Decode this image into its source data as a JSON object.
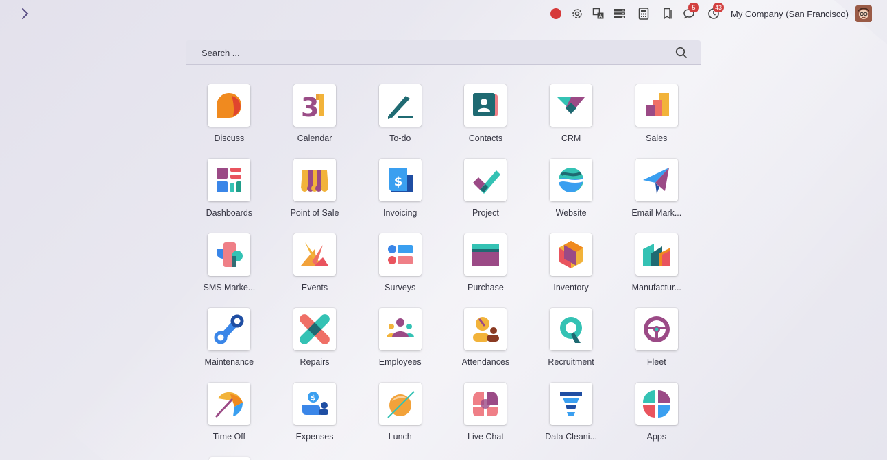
{
  "topbar": {
    "company": "My Company (San Francisco)",
    "messages_badge": "5",
    "activities_badge": "43",
    "icons": [
      "record-icon",
      "settings-icon",
      "translate-icon",
      "debug-icon",
      "calculator-icon",
      "bookmark-icon",
      "chat-icon",
      "clock-icon"
    ]
  },
  "search": {
    "placeholder": "Search ..."
  },
  "apps": [
    {
      "label": "Discuss",
      "icon": "discuss-icon"
    },
    {
      "label": "Calendar",
      "icon": "calendar-icon"
    },
    {
      "label": "To-do",
      "icon": "todo-icon"
    },
    {
      "label": "Contacts",
      "icon": "contacts-icon"
    },
    {
      "label": "CRM",
      "icon": "crm-icon"
    },
    {
      "label": "Sales",
      "icon": "sales-icon"
    },
    {
      "label": "Dashboards",
      "icon": "dashboards-icon"
    },
    {
      "label": "Point of Sale",
      "icon": "pos-icon"
    },
    {
      "label": "Invoicing",
      "icon": "invoicing-icon"
    },
    {
      "label": "Project",
      "icon": "project-icon"
    },
    {
      "label": "Website",
      "icon": "website-icon"
    },
    {
      "label": "Email Mark...",
      "icon": "email-marketing-icon"
    },
    {
      "label": "SMS Marke...",
      "icon": "sms-marketing-icon"
    },
    {
      "label": "Events",
      "icon": "events-icon"
    },
    {
      "label": "Surveys",
      "icon": "surveys-icon"
    },
    {
      "label": "Purchase",
      "icon": "purchase-icon"
    },
    {
      "label": "Inventory",
      "icon": "inventory-icon"
    },
    {
      "label": "Manufactur...",
      "icon": "manufacturing-icon"
    },
    {
      "label": "Maintenance",
      "icon": "maintenance-icon"
    },
    {
      "label": "Repairs",
      "icon": "repairs-icon"
    },
    {
      "label": "Employees",
      "icon": "employees-icon"
    },
    {
      "label": "Attendances",
      "icon": "attendances-icon"
    },
    {
      "label": "Recruitment",
      "icon": "recruitment-icon"
    },
    {
      "label": "Fleet",
      "icon": "fleet-icon"
    },
    {
      "label": "Time Off",
      "icon": "time-off-icon"
    },
    {
      "label": "Expenses",
      "icon": "expenses-icon"
    },
    {
      "label": "Lunch",
      "icon": "lunch-icon"
    },
    {
      "label": "Live Chat",
      "icon": "live-chat-icon"
    },
    {
      "label": "Data Cleani...",
      "icon": "data-cleaning-icon"
    },
    {
      "label": "Apps",
      "icon": "apps-icon"
    }
  ]
}
